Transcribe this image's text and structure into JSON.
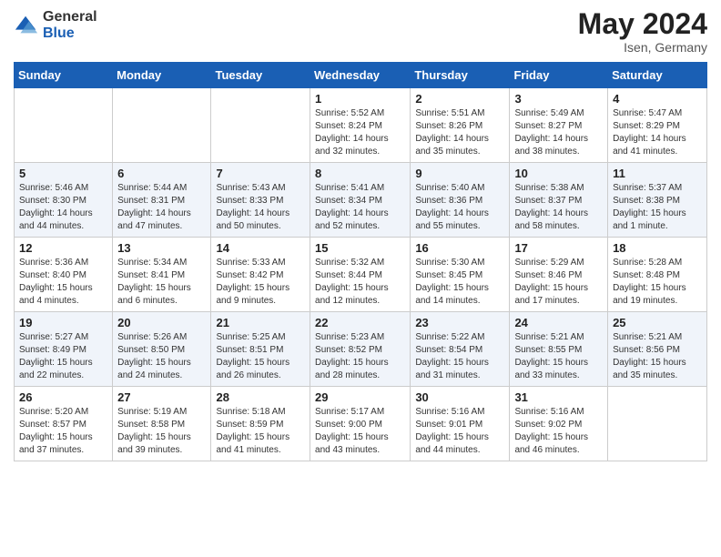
{
  "header": {
    "logo_general": "General",
    "logo_blue": "Blue",
    "month_year": "May 2024",
    "location": "Isen, Germany"
  },
  "days_of_week": [
    "Sunday",
    "Monday",
    "Tuesday",
    "Wednesday",
    "Thursday",
    "Friday",
    "Saturday"
  ],
  "weeks": [
    [
      {
        "day": "",
        "sunrise": "",
        "sunset": "",
        "daylight": ""
      },
      {
        "day": "",
        "sunrise": "",
        "sunset": "",
        "daylight": ""
      },
      {
        "day": "",
        "sunrise": "",
        "sunset": "",
        "daylight": ""
      },
      {
        "day": "1",
        "sunrise": "Sunrise: 5:52 AM",
        "sunset": "Sunset: 8:24 PM",
        "daylight": "Daylight: 14 hours and 32 minutes."
      },
      {
        "day": "2",
        "sunrise": "Sunrise: 5:51 AM",
        "sunset": "Sunset: 8:26 PM",
        "daylight": "Daylight: 14 hours and 35 minutes."
      },
      {
        "day": "3",
        "sunrise": "Sunrise: 5:49 AM",
        "sunset": "Sunset: 8:27 PM",
        "daylight": "Daylight: 14 hours and 38 minutes."
      },
      {
        "day": "4",
        "sunrise": "Sunrise: 5:47 AM",
        "sunset": "Sunset: 8:29 PM",
        "daylight": "Daylight: 14 hours and 41 minutes."
      }
    ],
    [
      {
        "day": "5",
        "sunrise": "Sunrise: 5:46 AM",
        "sunset": "Sunset: 8:30 PM",
        "daylight": "Daylight: 14 hours and 44 minutes."
      },
      {
        "day": "6",
        "sunrise": "Sunrise: 5:44 AM",
        "sunset": "Sunset: 8:31 PM",
        "daylight": "Daylight: 14 hours and 47 minutes."
      },
      {
        "day": "7",
        "sunrise": "Sunrise: 5:43 AM",
        "sunset": "Sunset: 8:33 PM",
        "daylight": "Daylight: 14 hours and 50 minutes."
      },
      {
        "day": "8",
        "sunrise": "Sunrise: 5:41 AM",
        "sunset": "Sunset: 8:34 PM",
        "daylight": "Daylight: 14 hours and 52 minutes."
      },
      {
        "day": "9",
        "sunrise": "Sunrise: 5:40 AM",
        "sunset": "Sunset: 8:36 PM",
        "daylight": "Daylight: 14 hours and 55 minutes."
      },
      {
        "day": "10",
        "sunrise": "Sunrise: 5:38 AM",
        "sunset": "Sunset: 8:37 PM",
        "daylight": "Daylight: 14 hours and 58 minutes."
      },
      {
        "day": "11",
        "sunrise": "Sunrise: 5:37 AM",
        "sunset": "Sunset: 8:38 PM",
        "daylight": "Daylight: 15 hours and 1 minute."
      }
    ],
    [
      {
        "day": "12",
        "sunrise": "Sunrise: 5:36 AM",
        "sunset": "Sunset: 8:40 PM",
        "daylight": "Daylight: 15 hours and 4 minutes."
      },
      {
        "day": "13",
        "sunrise": "Sunrise: 5:34 AM",
        "sunset": "Sunset: 8:41 PM",
        "daylight": "Daylight: 15 hours and 6 minutes."
      },
      {
        "day": "14",
        "sunrise": "Sunrise: 5:33 AM",
        "sunset": "Sunset: 8:42 PM",
        "daylight": "Daylight: 15 hours and 9 minutes."
      },
      {
        "day": "15",
        "sunrise": "Sunrise: 5:32 AM",
        "sunset": "Sunset: 8:44 PM",
        "daylight": "Daylight: 15 hours and 12 minutes."
      },
      {
        "day": "16",
        "sunrise": "Sunrise: 5:30 AM",
        "sunset": "Sunset: 8:45 PM",
        "daylight": "Daylight: 15 hours and 14 minutes."
      },
      {
        "day": "17",
        "sunrise": "Sunrise: 5:29 AM",
        "sunset": "Sunset: 8:46 PM",
        "daylight": "Daylight: 15 hours and 17 minutes."
      },
      {
        "day": "18",
        "sunrise": "Sunrise: 5:28 AM",
        "sunset": "Sunset: 8:48 PM",
        "daylight": "Daylight: 15 hours and 19 minutes."
      }
    ],
    [
      {
        "day": "19",
        "sunrise": "Sunrise: 5:27 AM",
        "sunset": "Sunset: 8:49 PM",
        "daylight": "Daylight: 15 hours and 22 minutes."
      },
      {
        "day": "20",
        "sunrise": "Sunrise: 5:26 AM",
        "sunset": "Sunset: 8:50 PM",
        "daylight": "Daylight: 15 hours and 24 minutes."
      },
      {
        "day": "21",
        "sunrise": "Sunrise: 5:25 AM",
        "sunset": "Sunset: 8:51 PM",
        "daylight": "Daylight: 15 hours and 26 minutes."
      },
      {
        "day": "22",
        "sunrise": "Sunrise: 5:23 AM",
        "sunset": "Sunset: 8:52 PM",
        "daylight": "Daylight: 15 hours and 28 minutes."
      },
      {
        "day": "23",
        "sunrise": "Sunrise: 5:22 AM",
        "sunset": "Sunset: 8:54 PM",
        "daylight": "Daylight: 15 hours and 31 minutes."
      },
      {
        "day": "24",
        "sunrise": "Sunrise: 5:21 AM",
        "sunset": "Sunset: 8:55 PM",
        "daylight": "Daylight: 15 hours and 33 minutes."
      },
      {
        "day": "25",
        "sunrise": "Sunrise: 5:21 AM",
        "sunset": "Sunset: 8:56 PM",
        "daylight": "Daylight: 15 hours and 35 minutes."
      }
    ],
    [
      {
        "day": "26",
        "sunrise": "Sunrise: 5:20 AM",
        "sunset": "Sunset: 8:57 PM",
        "daylight": "Daylight: 15 hours and 37 minutes."
      },
      {
        "day": "27",
        "sunrise": "Sunrise: 5:19 AM",
        "sunset": "Sunset: 8:58 PM",
        "daylight": "Daylight: 15 hours and 39 minutes."
      },
      {
        "day": "28",
        "sunrise": "Sunrise: 5:18 AM",
        "sunset": "Sunset: 8:59 PM",
        "daylight": "Daylight: 15 hours and 41 minutes."
      },
      {
        "day": "29",
        "sunrise": "Sunrise: 5:17 AM",
        "sunset": "Sunset: 9:00 PM",
        "daylight": "Daylight: 15 hours and 43 minutes."
      },
      {
        "day": "30",
        "sunrise": "Sunrise: 5:16 AM",
        "sunset": "Sunset: 9:01 PM",
        "daylight": "Daylight: 15 hours and 44 minutes."
      },
      {
        "day": "31",
        "sunrise": "Sunrise: 5:16 AM",
        "sunset": "Sunset: 9:02 PM",
        "daylight": "Daylight: 15 hours and 46 minutes."
      },
      {
        "day": "",
        "sunrise": "",
        "sunset": "",
        "daylight": ""
      }
    ]
  ]
}
